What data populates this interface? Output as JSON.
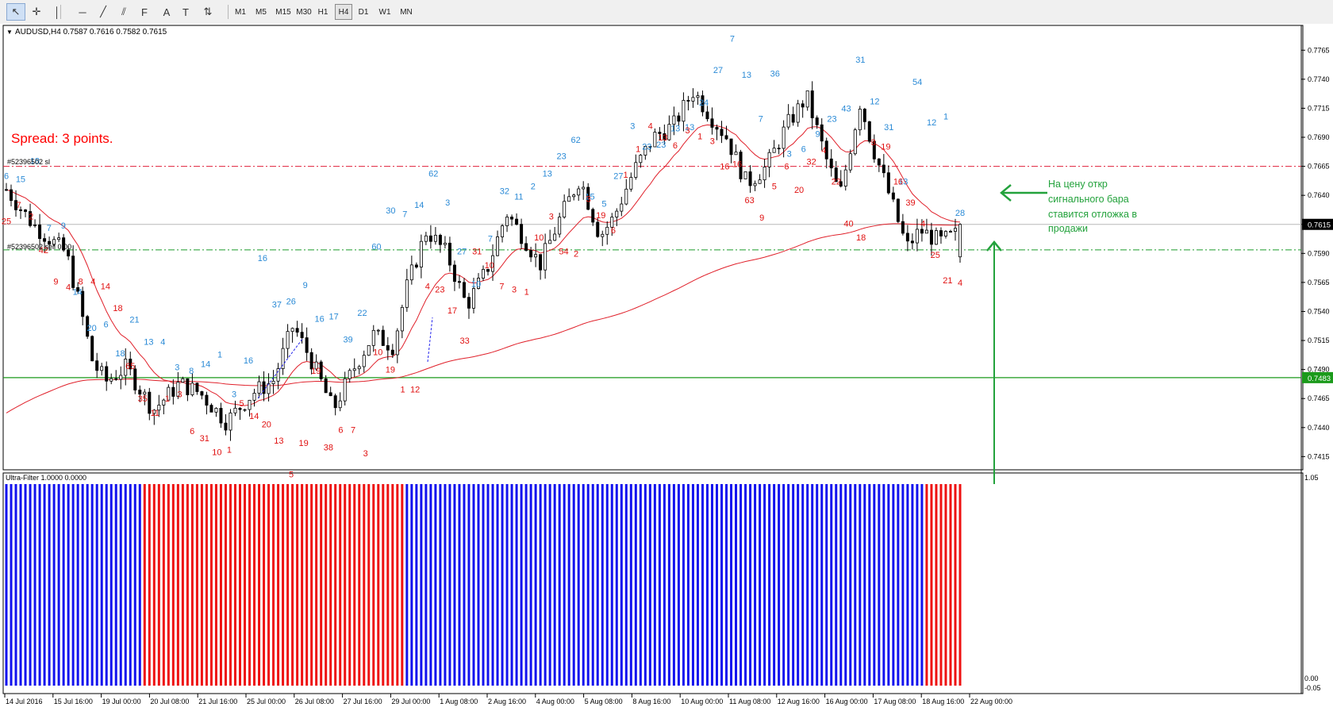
{
  "toolbar": {
    "tools": [
      {
        "name": "cursor-tool-button",
        "icon": "cursor-icon",
        "glyph": "↖",
        "active": true
      },
      {
        "name": "crosshair-tool-button",
        "icon": "crosshair-icon",
        "glyph": "✛",
        "active": false
      },
      {
        "name": "vertical-line-tool-button",
        "icon": "vertical-line-icon",
        "glyph": "│",
        "active": false
      },
      {
        "name": "horizontal-line-tool-button",
        "icon": "horizontal-line-icon",
        "glyph": "─",
        "active": false
      },
      {
        "name": "trendline-tool-button",
        "icon": "trendline-icon",
        "glyph": "╱",
        "active": false
      },
      {
        "name": "channel-tool-button",
        "icon": "equidistant-channel-icon",
        "glyph": "⫽",
        "active": false
      },
      {
        "name": "fibonacci-tool-button",
        "icon": "fibonacci-icon",
        "glyph": "F",
        "active": false
      },
      {
        "name": "text-tool-button",
        "icon": "text-icon",
        "glyph": "A",
        "active": false
      },
      {
        "name": "text-label-tool-button",
        "icon": "text-label-icon",
        "glyph": "T",
        "active": false
      },
      {
        "name": "arrows-tool-button",
        "icon": "arrows-icon",
        "glyph": "⇅",
        "active": false
      }
    ],
    "timeframes": [
      {
        "label": "M1",
        "active": false
      },
      {
        "label": "M5",
        "active": false
      },
      {
        "label": "M15",
        "active": false
      },
      {
        "label": "M30",
        "active": false
      },
      {
        "label": "H1",
        "active": false
      },
      {
        "label": "H4",
        "active": true
      },
      {
        "label": "D1",
        "active": false
      },
      {
        "label": "W1",
        "active": false
      },
      {
        "label": "MN",
        "active": false
      }
    ]
  },
  "chart": {
    "header": "AUDUSD,H4  0.7587 0.7616 0.7582 0.7615",
    "spread_text": "Spread: 3 points.",
    "sl_label": "#52396502 sl",
    "tp_label": "#52396502 sell 0.00",
    "annotation_lines": [
      "На цену откр",
      "сигнального бара",
      "ставится отложка в",
      "продажи"
    ],
    "price_axis": [
      "0.7765",
      "0.7740",
      "0.7715",
      "0.7690",
      "0.7665",
      "0.7640",
      "0.7615",
      "0.7590",
      "0.7565",
      "0.7540",
      "0.7515",
      "0.7490",
      "0.7465",
      "0.7440",
      "0.7415"
    ],
    "current_price_label": "0.7615",
    "support_price_label": "0.7483",
    "date_axis": [
      "14 Jul 2016",
      "15 Jul 16:00",
      "19 Jul 00:00",
      "20 Jul 08:00",
      "21 Jul 16:00",
      "25 Jul 00:00",
      "26 Jul 08:00",
      "27 Jul 16:00",
      "29 Jul 00:00",
      "1 Aug 08:00",
      "2 Aug 16:00",
      "4 Aug 00:00",
      "5 Aug 08:00",
      "8 Aug 16:00",
      "10 Aug 00:00",
      "11 Aug 08:00",
      "12 Aug 16:00",
      "16 Aug 00:00",
      "17 Aug 08:00",
      "18 Aug 16:00",
      "22 Aug 00:00"
    ],
    "indicator_label": "Ultra-Filter 1.0000 0.0000",
    "indicator_axis": [
      "1.05",
      "0.00",
      "-0.05"
    ],
    "colors": {
      "bull_count": "#2a8ad6",
      "bear_count": "#e01010",
      "indicator_up": "#1111ee",
      "indicator_down": "#ee1111",
      "spread": "#ff0000",
      "annotation": "#23a23c",
      "ma": "#e0202a"
    }
  },
  "chart_data": {
    "type": "candlestick",
    "symbol": "AUDUSD",
    "timeframe": "H4",
    "ylim": [
      0.7405,
      0.7785
    ],
    "last_candle": {
      "open": 0.7587,
      "high": 0.7616,
      "low": 0.7582,
      "close": 0.7615
    },
    "levels": {
      "current": 0.7615,
      "stop_loss": 0.7665,
      "pending_sell": 0.7593,
      "support": 0.7483
    },
    "bull_counts": [
      {
        "label": "6",
        "price": 0.7657
      },
      {
        "label": "15",
        "price": 0.7654
      },
      {
        "label": "18",
        "price": 0.767
      },
      {
        "label": "7",
        "price": 0.7612
      },
      {
        "label": "9",
        "price": 0.7614
      },
      {
        "label": "14",
        "price": 0.7557
      },
      {
        "label": "20",
        "price": 0.7526
      },
      {
        "label": "6",
        "price": 0.7529
      },
      {
        "label": "18",
        "price": 0.7504
      },
      {
        "label": "21",
        "price": 0.7533
      },
      {
        "label": "13",
        "price": 0.7514
      },
      {
        "label": "4",
        "price": 0.7514
      },
      {
        "label": "3",
        "price": 0.7492
      },
      {
        "label": "8",
        "price": 0.7489
      },
      {
        "label": "14",
        "price": 0.7495
      },
      {
        "label": "1",
        "price": 0.7503
      },
      {
        "label": "3",
        "price": 0.7469
      },
      {
        "label": "16",
        "price": 0.7498
      },
      {
        "label": "16",
        "price": 0.7586
      },
      {
        "label": "37",
        "price": 0.7546
      },
      {
        "label": "26",
        "price": 0.7549
      },
      {
        "label": "9",
        "price": 0.7563
      },
      {
        "label": "16",
        "price": 0.7534
      },
      {
        "label": "17",
        "price": 0.7536
      },
      {
        "label": "39",
        "price": 0.7516
      },
      {
        "label": "22",
        "price": 0.7539
      },
      {
        "label": "60",
        "price": 0.7596
      },
      {
        "label": "30",
        "price": 0.7627
      },
      {
        "label": "7",
        "price": 0.7624
      },
      {
        "label": "14",
        "price": 0.7632
      },
      {
        "label": "62",
        "price": 0.7659
      },
      {
        "label": "3",
        "price": 0.7634
      },
      {
        "label": "27",
        "price": 0.7592
      },
      {
        "label": "10",
        "price": 0.7564
      },
      {
        "label": "7",
        "price": 0.7603
      },
      {
        "label": "32",
        "price": 0.7644
      },
      {
        "label": "11",
        "price": 0.7639
      },
      {
        "label": "2",
        "price": 0.7648
      },
      {
        "label": "13",
        "price": 0.7659
      },
      {
        "label": "23",
        "price": 0.7674
      },
      {
        "label": "62",
        "price": 0.7688
      },
      {
        "label": "15",
        "price": 0.7639
      },
      {
        "label": "5",
        "price": 0.7633
      },
      {
        "label": "27",
        "price": 0.7657
      },
      {
        "label": "3",
        "price": 0.77
      },
      {
        "label": "23",
        "price": 0.7682
      },
      {
        "label": "23",
        "price": 0.7684
      },
      {
        "label": "13",
        "price": 0.7698
      },
      {
        "label": "13",
        "price": 0.7699
      },
      {
        "label": "24",
        "price": 0.772
      },
      {
        "label": "27",
        "price": 0.7748
      },
      {
        "label": "7",
        "price": 0.7775
      },
      {
        "label": "13",
        "price": 0.7744
      },
      {
        "label": "7",
        "price": 0.7706
      },
      {
        "label": "36",
        "price": 0.7745
      },
      {
        "label": "3",
        "price": 0.7676
      },
      {
        "label": "6",
        "price": 0.768
      },
      {
        "label": "9",
        "price": 0.7693
      },
      {
        "label": "23",
        "price": 0.7706
      },
      {
        "label": "43",
        "price": 0.7715
      },
      {
        "label": "31",
        "price": 0.7757
      },
      {
        "label": "12",
        "price": 0.7721
      },
      {
        "label": "31",
        "price": 0.7699
      },
      {
        "label": "13",
        "price": 0.7652
      },
      {
        "label": "54",
        "price": 0.7738
      },
      {
        "label": "12",
        "price": 0.7703
      },
      {
        "label": "1",
        "price": 0.7708
      },
      {
        "label": "28",
        "price": 0.7625
      }
    ],
    "bear_counts": [
      {
        "label": "25",
        "price": 0.7618
      },
      {
        "label": "7",
        "price": 0.7632
      },
      {
        "label": "2",
        "price": 0.7622
      },
      {
        "label": "42",
        "price": 0.7593
      },
      {
        "label": "9",
        "price": 0.7566
      },
      {
        "label": "4",
        "price": 0.7561
      },
      {
        "label": "8",
        "price": 0.7566
      },
      {
        "label": "4",
        "price": 0.7566
      },
      {
        "label": "14",
        "price": 0.7562
      },
      {
        "label": "18",
        "price": 0.7543
      },
      {
        "label": "65",
        "price": 0.7493
      },
      {
        "label": "35",
        "price": 0.7465
      },
      {
        "label": "11",
        "price": 0.7453
      },
      {
        "label": "1",
        "price": 0.7465
      },
      {
        "label": "3",
        "price": 0.7469
      },
      {
        "label": "6",
        "price": 0.7437
      },
      {
        "label": "31",
        "price": 0.7431
      },
      {
        "label": "10",
        "price": 0.7419
      },
      {
        "label": "1",
        "price": 0.7421
      },
      {
        "label": "5",
        "price": 0.7461
      },
      {
        "label": "14",
        "price": 0.745
      },
      {
        "label": "20",
        "price": 0.7443
      },
      {
        "label": "13",
        "price": 0.7429
      },
      {
        "label": "5",
        "price": 0.74
      },
      {
        "label": "19",
        "price": 0.7427
      },
      {
        "label": "19",
        "price": 0.7489
      },
      {
        "label": "38",
        "price": 0.7423
      },
      {
        "label": "6",
        "price": 0.7438
      },
      {
        "label": "7",
        "price": 0.7438
      },
      {
        "label": "3",
        "price": 0.7418
      },
      {
        "label": "10",
        "price": 0.7505
      },
      {
        "label": "19",
        "price": 0.749
      },
      {
        "label": "1",
        "price": 0.7473
      },
      {
        "label": "12",
        "price": 0.7473
      },
      {
        "label": "4",
        "price": 0.7562
      },
      {
        "label": "23",
        "price": 0.7559
      },
      {
        "label": "17",
        "price": 0.7541
      },
      {
        "label": "33",
        "price": 0.7515
      },
      {
        "label": "31",
        "price": 0.7592
      },
      {
        "label": "10",
        "price": 0.758
      },
      {
        "label": "7",
        "price": 0.7562
      },
      {
        "label": "3",
        "price": 0.7559
      },
      {
        "label": "1",
        "price": 0.7557
      },
      {
        "label": "10",
        "price": 0.7604
      },
      {
        "label": "3",
        "price": 0.7622
      },
      {
        "label": "54",
        "price": 0.7592
      },
      {
        "label": "2",
        "price": 0.759
      },
      {
        "label": "3",
        "price": 0.7637
      },
      {
        "label": "19",
        "price": 0.7623
      },
      {
        "label": "6",
        "price": 0.761
      },
      {
        "label": "1",
        "price": 0.7658
      },
      {
        "label": "1",
        "price": 0.768
      },
      {
        "label": "4",
        "price": 0.77
      },
      {
        "label": "13",
        "price": 0.769
      },
      {
        "label": "6",
        "price": 0.7683
      },
      {
        "label": "3",
        "price": 0.7696
      },
      {
        "label": "1",
        "price": 0.7691
      },
      {
        "label": "3",
        "price": 0.7687
      },
      {
        "label": "16",
        "price": 0.7665
      },
      {
        "label": "16",
        "price": 0.7667
      },
      {
        "label": "63",
        "price": 0.7636
      },
      {
        "label": "9",
        "price": 0.7621
      },
      {
        "label": "5",
        "price": 0.7648
      },
      {
        "label": "6",
        "price": 0.7665
      },
      {
        "label": "20",
        "price": 0.7645
      },
      {
        "label": "32",
        "price": 0.7669
      },
      {
        "label": "4",
        "price": 0.7679
      },
      {
        "label": "22",
        "price": 0.7652
      },
      {
        "label": "40",
        "price": 0.7616
      },
      {
        "label": "18",
        "price": 0.7604
      },
      {
        "label": "3",
        "price": 0.7686
      },
      {
        "label": "19",
        "price": 0.7682
      },
      {
        "label": "16",
        "price": 0.7652
      },
      {
        "label": "39",
        "price": 0.7634
      },
      {
        "label": "4",
        "price": 0.7616
      },
      {
        "label": "25",
        "price": 0.7589
      },
      {
        "label": "21",
        "price": 0.7567
      },
      {
        "label": "4",
        "price": 0.7565
      }
    ],
    "indicator": {
      "name": "Ultra-Filter",
      "ylim": [
        -0.05,
        1.05
      ],
      "segments": [
        {
          "state": "up",
          "bars": 29
        },
        {
          "state": "down",
          "bars": 55
        },
        {
          "state": "up",
          "bars": 109
        },
        {
          "state": "down",
          "bars": 8
        }
      ]
    }
  }
}
